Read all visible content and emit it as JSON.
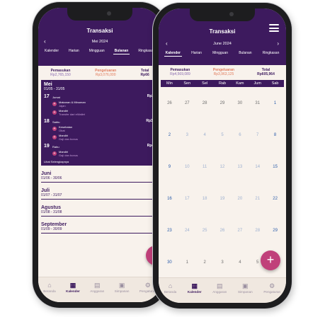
{
  "back": {
    "title": "Transaksi",
    "month": "Mei 2024",
    "tabs": [
      "Kalender",
      "Harian",
      "Mingguan",
      "Bulanan",
      "Ringkasan"
    ],
    "summary": {
      "in_label": "Pemasukan",
      "out_label": "Pengeluaran",
      "total_label": "Total",
      "in_value": "Rp2,765,150",
      "out_value": "Rp3,076,000",
      "total_value": "Rp66"
    },
    "current_month": {
      "name": "Mei",
      "range": "01/05 - 31/05",
      "days": [
        {
          "num": "17",
          "name": "Jumat",
          "amount": "Rp22",
          "txns": [
            {
              "icon": "+",
              "label": "Makanan & Minuman",
              "cat": "Jajan"
            },
            {
              "icon": "+",
              "label": "Mandiri",
              "cat": "Transfer dari eWallet"
            }
          ]
        },
        {
          "num": "18",
          "name": "Sabtu",
          "amount": "Rp37,",
          "txns": [
            {
              "icon": "+",
              "label": "Kesehatan",
              "cat": "Obat"
            },
            {
              "icon": "+",
              "label": "Mandiri",
              "cat": "Gaji dan bonus"
            }
          ]
        },
        {
          "num": "19",
          "name": "Rabu",
          "amount": "Rp49",
          "txns": [
            {
              "icon": "+",
              "label": "Mandiri",
              "cat": "Gaji dan bonus"
            }
          ]
        }
      ],
      "see_all": "Lihat Selengkapnya"
    },
    "months": [
      {
        "name": "Juni",
        "range": "01/06 - 30/06"
      },
      {
        "name": "Juli",
        "range": "01/07 - 31/07"
      },
      {
        "name": "Agustus",
        "range": "01/08 - 31/08"
      },
      {
        "name": "September",
        "range": "01/09 - 30/09"
      }
    ],
    "nav": [
      {
        "label": "Beranda",
        "icon": "⌂"
      },
      {
        "label": "Kalender",
        "icon": "▦"
      },
      {
        "label": "Anggaran",
        "icon": "▤"
      },
      {
        "label": "Simpanan",
        "icon": "▣"
      },
      {
        "label": "Pengaturan",
        "icon": "⚙"
      }
    ]
  },
  "front": {
    "title": "Transaksi",
    "month": "June 2024",
    "tabs": [
      "Kalender",
      "Harian",
      "Mingguan",
      "Bulanan",
      "Ringkasan"
    ],
    "summary": {
      "in_label": "Pemasukan",
      "out_label": "Pengeluaran",
      "total_label": "Total",
      "in_value": "Rp4,569,089",
      "out_value": "Rp3,963,125",
      "total_value": "Rp605,964"
    },
    "weekdays": [
      "Min",
      "Sen",
      "Sel",
      "Rab",
      "Kam",
      "Jum",
      "Sab"
    ],
    "weeks": [
      [
        "26",
        "27",
        "28",
        "29",
        "30",
        "31",
        "1"
      ],
      [
        "2",
        "3",
        "4",
        "5",
        "6",
        "7",
        "8"
      ],
      [
        "9",
        "10",
        "11",
        "12",
        "13",
        "14",
        "15"
      ],
      [
        "16",
        "17",
        "18",
        "19",
        "20",
        "21",
        "22"
      ],
      [
        "23",
        "24",
        "25",
        "26",
        "27",
        "28",
        "29"
      ],
      [
        "30",
        "1",
        "2",
        "3",
        "4",
        "5",
        "6"
      ]
    ],
    "nav": [
      {
        "label": "Beranda",
        "icon": "⌂"
      },
      {
        "label": "Kalender",
        "icon": "▦"
      },
      {
        "label": "Anggaran",
        "icon": "▤"
      },
      {
        "label": "Simpanan",
        "icon": "▣"
      },
      {
        "label": "Pengaturan",
        "icon": "⚙"
      }
    ],
    "fab": "+"
  }
}
